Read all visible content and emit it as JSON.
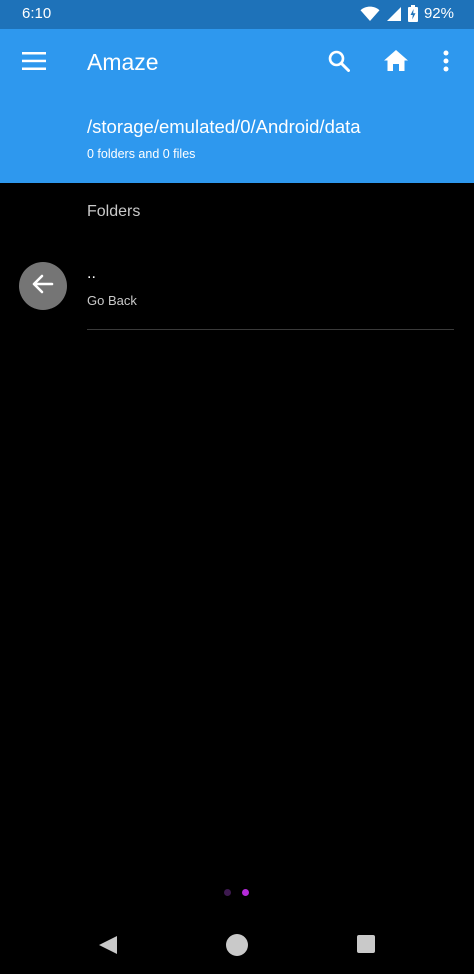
{
  "status_bar": {
    "time": "6:10",
    "battery": "92%",
    "icons": [
      "wifi-icon",
      "signal-icon",
      "battery-charging-icon"
    ]
  },
  "app_bar": {
    "title": "Amaze",
    "path": "/storage/emulated/0/Android/data",
    "counts": "0 folders and 0 files",
    "icons": [
      "menu-icon",
      "search-icon",
      "home-icon",
      "more-vert-icon"
    ]
  },
  "content": {
    "section_header": "Folders",
    "items": [
      {
        "name": "..",
        "subtitle": "Go Back",
        "icon": "arrow-back-icon"
      }
    ]
  },
  "page_indicator": {
    "count": 2,
    "active_index": 1
  },
  "nav_bar": {
    "icons": [
      "nav-back-icon",
      "nav-home-icon",
      "nav-recents-icon"
    ]
  },
  "colors": {
    "primary": "#2e98ee",
    "status_bar": "#1e72b9",
    "background": "#000000",
    "avatar": "#757575",
    "dot_active": "#b52ad9",
    "dot_inactive": "#3d1a4f",
    "nav_icon": "#c9c9c9"
  }
}
